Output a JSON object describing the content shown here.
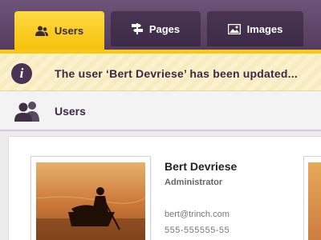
{
  "nav": {
    "tabs": [
      {
        "label": "Users",
        "icon": "users-icon",
        "active": true
      },
      {
        "label": "Pages",
        "icon": "signpost-icon",
        "active": false
      },
      {
        "label": "Images",
        "icon": "picture-icon",
        "active": false
      }
    ]
  },
  "notification": {
    "icon": "info-icon",
    "glyph": "i",
    "message": "The user ‘Bert Devriese’ has been updated..."
  },
  "section": {
    "icon": "people-icon",
    "title": "Users"
  },
  "user_card": {
    "name": "Bert Devriese",
    "role": "Administrator",
    "email": "bert@trinch.com",
    "phone": "555-555555-55"
  },
  "colors": {
    "nav_bg": "#5e4669",
    "active_tab": "#f7c81a",
    "tab_bg": "#432f4d",
    "text_dark": "#3b2a45",
    "notification_bg": "#fbf1cf"
  }
}
